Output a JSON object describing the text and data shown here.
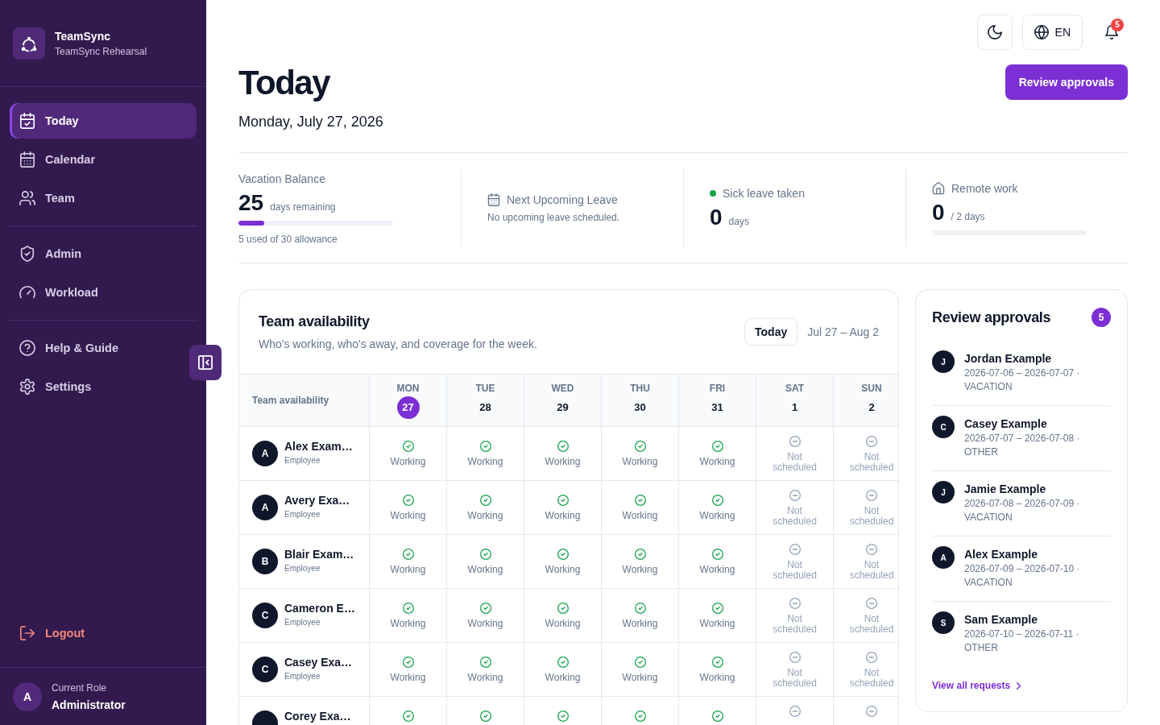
{
  "sidebar": {
    "brand": {
      "name": "TeamSync",
      "workspace": "TeamSync Rehearsal"
    },
    "nav": [
      {
        "items": [
          {
            "kind": "today",
            "label": "Today",
            "selected": true
          },
          {
            "kind": "calendar",
            "label": "Calendar",
            "selected": false
          },
          {
            "kind": "team",
            "label": "Team",
            "selected": false
          }
        ]
      },
      {
        "items": [
          {
            "kind": "admin",
            "label": "Admin",
            "selected": false
          },
          {
            "kind": "workload",
            "label": "Workload",
            "selected": false
          }
        ]
      },
      {
        "items": [
          {
            "kind": "help",
            "label": "Help & Guide",
            "selected": false
          },
          {
            "kind": "settings",
            "label": "Settings",
            "selected": false
          }
        ]
      }
    ],
    "logout": "Logout",
    "user": {
      "initial": "A",
      "caption": "Current Role",
      "role": "Administrator"
    }
  },
  "toolbar": {
    "language": "EN",
    "notification_count": "5"
  },
  "header": {
    "title": "Today",
    "date": "Monday, July 27, 2026",
    "action": "Review approvals"
  },
  "stats": [
    {
      "kind": "balance",
      "label": "Vacation Balance",
      "value": "25",
      "unit": "days remaining",
      "level": 0.167,
      "note": "5 used of 30 allowance"
    },
    {
      "kind": "upcoming",
      "label": "Next Upcoming Leave",
      "note": "No upcoming leave scheduled."
    },
    {
      "kind": "sick",
      "label": "Sick leave taken",
      "value": "0",
      "unit": "days"
    },
    {
      "kind": "remote",
      "label": "Remote work",
      "value": "0",
      "unit": "/ 2 days",
      "level": 0
    }
  ],
  "availability": {
    "title": "Team availability",
    "subtitle": "Who's working, who's away, and coverage for the week.",
    "today_button": "Today",
    "range": "Jul 27 – Aug 2",
    "corner_label": "Team availability",
    "days": [
      {
        "name": "MON",
        "date": "27",
        "selected": true
      },
      {
        "name": "TUE",
        "date": "28",
        "selected": false
      },
      {
        "name": "WED",
        "date": "29",
        "selected": false
      },
      {
        "name": "THU",
        "date": "30",
        "selected": false
      },
      {
        "name": "FRI",
        "date": "31",
        "selected": false
      },
      {
        "name": "SAT",
        "date": "1",
        "selected": false
      },
      {
        "name": "SUN",
        "date": "2",
        "selected": false
      }
    ],
    "rows": [
      {
        "initial": "A",
        "name": "Alex Exam…",
        "role": "Employee",
        "cells": [
          {
            "kind": "working",
            "label": "Working"
          },
          {
            "kind": "working",
            "label": "Working"
          },
          {
            "kind": "working",
            "label": "Working"
          },
          {
            "kind": "working",
            "label": "Working"
          },
          {
            "kind": "working",
            "label": "Working"
          },
          {
            "kind": "not_scheduled",
            "label": "Not scheduled"
          },
          {
            "kind": "not_scheduled",
            "label": "Not scheduled"
          }
        ]
      },
      {
        "initial": "A",
        "name": "Avery Exa…",
        "role": "Employee",
        "cells": [
          {
            "kind": "working",
            "label": "Working"
          },
          {
            "kind": "working",
            "label": "Working"
          },
          {
            "kind": "working",
            "label": "Working"
          },
          {
            "kind": "working",
            "label": "Working"
          },
          {
            "kind": "working",
            "label": "Working"
          },
          {
            "kind": "not_scheduled",
            "label": "Not scheduled"
          },
          {
            "kind": "not_scheduled",
            "label": "Not scheduled"
          }
        ]
      },
      {
        "initial": "B",
        "name": "Blair Exam…",
        "role": "Employee",
        "cells": [
          {
            "kind": "working",
            "label": "Working"
          },
          {
            "kind": "working",
            "label": "Working"
          },
          {
            "kind": "working",
            "label": "Working"
          },
          {
            "kind": "working",
            "label": "Working"
          },
          {
            "kind": "working",
            "label": "Working"
          },
          {
            "kind": "not_scheduled",
            "label": "Not scheduled"
          },
          {
            "kind": "not_scheduled",
            "label": "Not scheduled"
          }
        ]
      },
      {
        "initial": "C",
        "name": "Cameron E…",
        "role": "Employee",
        "cells": [
          {
            "kind": "working",
            "label": "Working"
          },
          {
            "kind": "working",
            "label": "Working"
          },
          {
            "kind": "working",
            "label": "Working"
          },
          {
            "kind": "working",
            "label": "Working"
          },
          {
            "kind": "working",
            "label": "Working"
          },
          {
            "kind": "not_scheduled",
            "label": "Not scheduled"
          },
          {
            "kind": "not_scheduled",
            "label": "Not scheduled"
          }
        ]
      },
      {
        "initial": "C",
        "name": "Casey Exa…",
        "role": "Employee",
        "cells": [
          {
            "kind": "working",
            "label": "Working"
          },
          {
            "kind": "working",
            "label": "Working"
          },
          {
            "kind": "working",
            "label": "Working"
          },
          {
            "kind": "working",
            "label": "Working"
          },
          {
            "kind": "working",
            "label": "Working"
          },
          {
            "kind": "not_scheduled",
            "label": "Not scheduled"
          },
          {
            "kind": "not_scheduled",
            "label": "Not scheduled"
          }
        ]
      },
      {
        "name": "Corey Exa…",
        "cells": [
          {
            "kind": "working"
          },
          {
            "kind": "working"
          },
          {
            "kind": "working"
          },
          {
            "kind": "working"
          },
          {
            "kind": "working"
          },
          {
            "kind": "not_scheduled"
          },
          {
            "kind": "not_scheduled"
          }
        ]
      }
    ]
  },
  "approvals": {
    "title": "Review approvals",
    "count": "5",
    "items": [
      {
        "initial": "J",
        "name": "Jordan Example",
        "details": "2026-07-06 – 2026-07-07 · VACATION"
      },
      {
        "initial": "C",
        "name": "Casey Example",
        "details": "2026-07-07 – 2026-07-08 · OTHER"
      },
      {
        "initial": "J",
        "name": "Jamie Example",
        "details": "2026-07-08 – 2026-07-09 · VACATION"
      },
      {
        "initial": "A",
        "name": "Alex Example",
        "details": "2026-07-09 – 2026-07-10 · VACATION"
      },
      {
        "initial": "S",
        "name": "Sam Example",
        "details": "2026-07-10 – 2026-07-11 · OTHER"
      }
    ],
    "link": "View all requests"
  }
}
